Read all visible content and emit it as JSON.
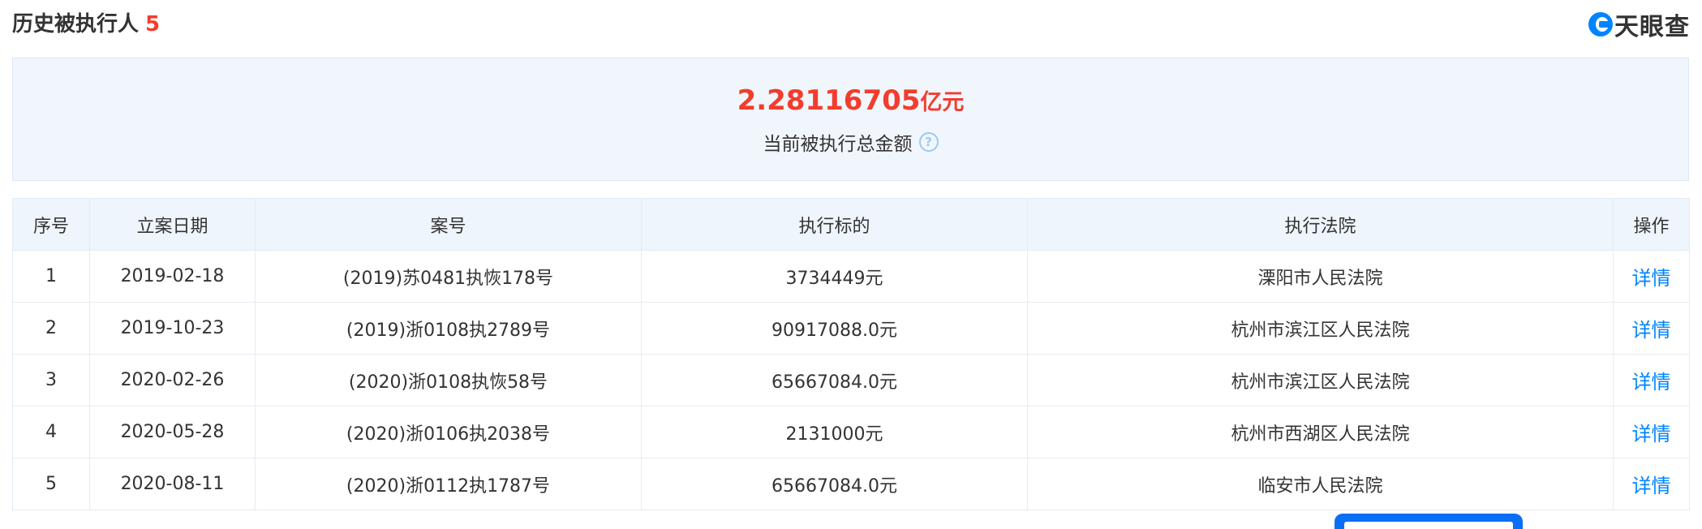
{
  "header": {
    "title": "历史被执行人",
    "count": "5",
    "logo_text": "天眼查"
  },
  "summary": {
    "amount": "2.28116705",
    "unit": "亿元",
    "label": "当前被执行总金额",
    "help_glyph": "?"
  },
  "table": {
    "columns": [
      "序号",
      "立案日期",
      "案号",
      "执行标的",
      "执行法院",
      "操作"
    ],
    "rows": [
      {
        "index": "1",
        "date": "2019-02-18",
        "case_no": "(2019)苏0481执恢178号",
        "amount": "3734449元",
        "court": "溧阳市人民法院",
        "action": "详情"
      },
      {
        "index": "2",
        "date": "2019-10-23",
        "case_no": "(2019)浙0108执2789号",
        "amount": "90917088.0元",
        "court": "杭州市滨江区人民法院",
        "action": "详情"
      },
      {
        "index": "3",
        "date": "2020-02-26",
        "case_no": "(2020)浙0108执恢58号",
        "amount": "65667084.0元",
        "court": "杭州市滨江区人民法院",
        "action": "详情"
      },
      {
        "index": "4",
        "date": "2020-05-28",
        "case_no": "(2020)浙0106执2038号",
        "amount": "2131000元",
        "court": "杭州市西湖区人民法院",
        "action": "详情"
      },
      {
        "index": "5",
        "date": "2020-08-11",
        "case_no": "(2020)浙0112执1787号",
        "amount": "65667084.0元",
        "court": "临安市人民法院",
        "action": "详情"
      }
    ]
  },
  "colors": {
    "accent_red": "#f23d2e",
    "link_blue": "#0084ff",
    "summary_bg": "#f0f6fc"
  }
}
